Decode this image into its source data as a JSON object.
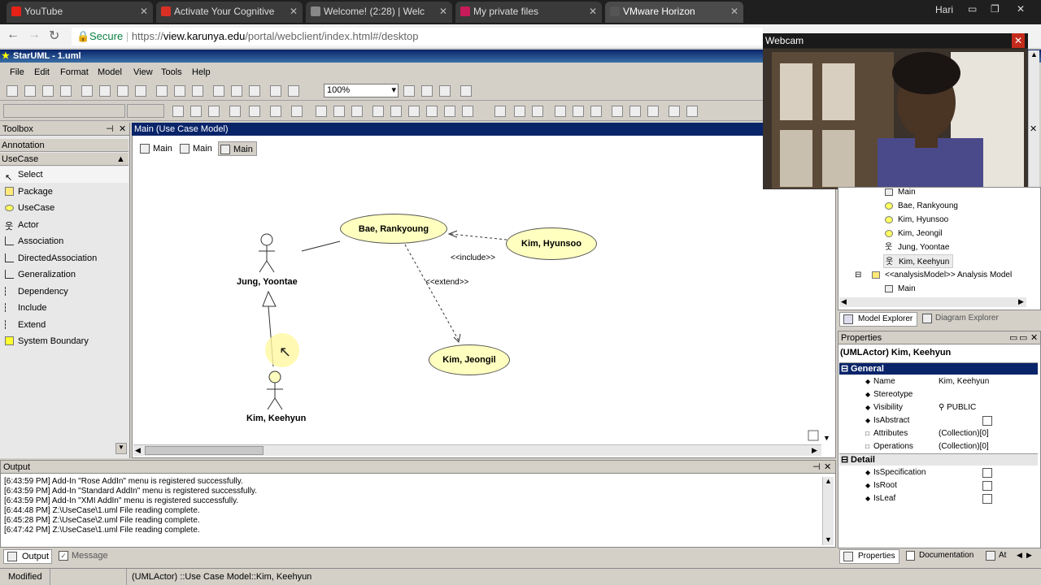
{
  "browser": {
    "tabs": [
      {
        "title": "YouTube",
        "color": "#e62117"
      },
      {
        "title": "Activate Your Cognitive",
        "color": "#d93025"
      },
      {
        "title": "Welcome! (2:28) | Welc",
        "color": "#888888"
      },
      {
        "title": "My private files",
        "color": "#c81b5a"
      },
      {
        "title": "VMware Horizon",
        "color": "#555555"
      }
    ],
    "user": "Hari",
    "secure_label": "Secure",
    "url_prefix": "https://",
    "url_host": "view.karunya.edu",
    "url_path": "/portal/webclient/index.html#/desktop"
  },
  "app": {
    "title": "StarUML - 1.uml",
    "menus": [
      "File",
      "Edit",
      "Format",
      "Model",
      "View",
      "Tools",
      "Help"
    ],
    "zoom": "100%"
  },
  "toolbox": {
    "title": "Toolbox",
    "sections": [
      "Annotation",
      "UseCase"
    ],
    "items": [
      "Select",
      "Package",
      "UseCase",
      "Actor",
      "Association",
      "DirectedAssociation",
      "Generalization",
      "Dependency",
      "Include",
      "Extend",
      "System Boundary"
    ]
  },
  "diagram": {
    "title": "Main (Use Case Model)",
    "tabs": [
      "Main",
      "Main",
      "Main"
    ],
    "usecases": [
      "Bae, Rankyoung",
      "Kim, Hyunsoo",
      "Kim, Jeongil"
    ],
    "actors": [
      "Jung, Yoontae",
      "Kim, Keehyun"
    ],
    "include_label": "<<include>>",
    "extend_label": "<<extend>>"
  },
  "webcam": {
    "title": "Webcam"
  },
  "model_explorer": {
    "items": [
      "Main",
      "Bae, Rankyoung",
      "Kim, Hyunsoo",
      "Kim, Jeongil",
      "Jung, Yoontae",
      "Kim, Keehyun",
      "<<analysisModel>> Analysis Model",
      "Main"
    ],
    "tabs": [
      "Model Explorer",
      "Diagram Explorer"
    ]
  },
  "properties": {
    "title": "Properties",
    "selected": "(UMLActor) Kim, Keehyun",
    "general_label": "General",
    "detail_label": "Detail",
    "rows": [
      {
        "name": "Name",
        "value": "Kim, Keehyun"
      },
      {
        "name": "Stereotype",
        "value": ""
      },
      {
        "name": "Visibility",
        "value": "PUBLIC"
      },
      {
        "name": "IsAbstract",
        "value": ""
      },
      {
        "name": "Attributes",
        "value": "(Collection)[0]"
      },
      {
        "name": "Operations",
        "value": "(Collection)[0]"
      }
    ],
    "detail_rows": [
      {
        "name": "IsSpecification"
      },
      {
        "name": "IsRoot"
      },
      {
        "name": "IsLeaf"
      }
    ],
    "bottom_tabs": [
      "Properties",
      "Documentation",
      "At"
    ]
  },
  "output": {
    "title": "Output",
    "lines": [
      "[6:43:59 PM]  Add-In \"Rose AddIn\" menu is registered successfully.",
      "[6:43:59 PM]  Add-In \"Standard AddIn\" menu is registered successfully.",
      "[6:43:59 PM]  Add-In \"XMI AddIn\" menu is registered successfully.",
      "[6:44:48 PM]  Z:\\UseCase\\1.uml File reading complete.",
      "[6:45:28 PM]  Z:\\UseCase\\2.uml File reading complete.",
      "[6:47:42 PM]  Z:\\UseCase\\1.uml File reading complete."
    ],
    "tabs": [
      "Output",
      "Message"
    ]
  },
  "status": {
    "state": "Modified",
    "path": "(UMLActor) ::Use Case Model::Kim, Keehyun"
  }
}
